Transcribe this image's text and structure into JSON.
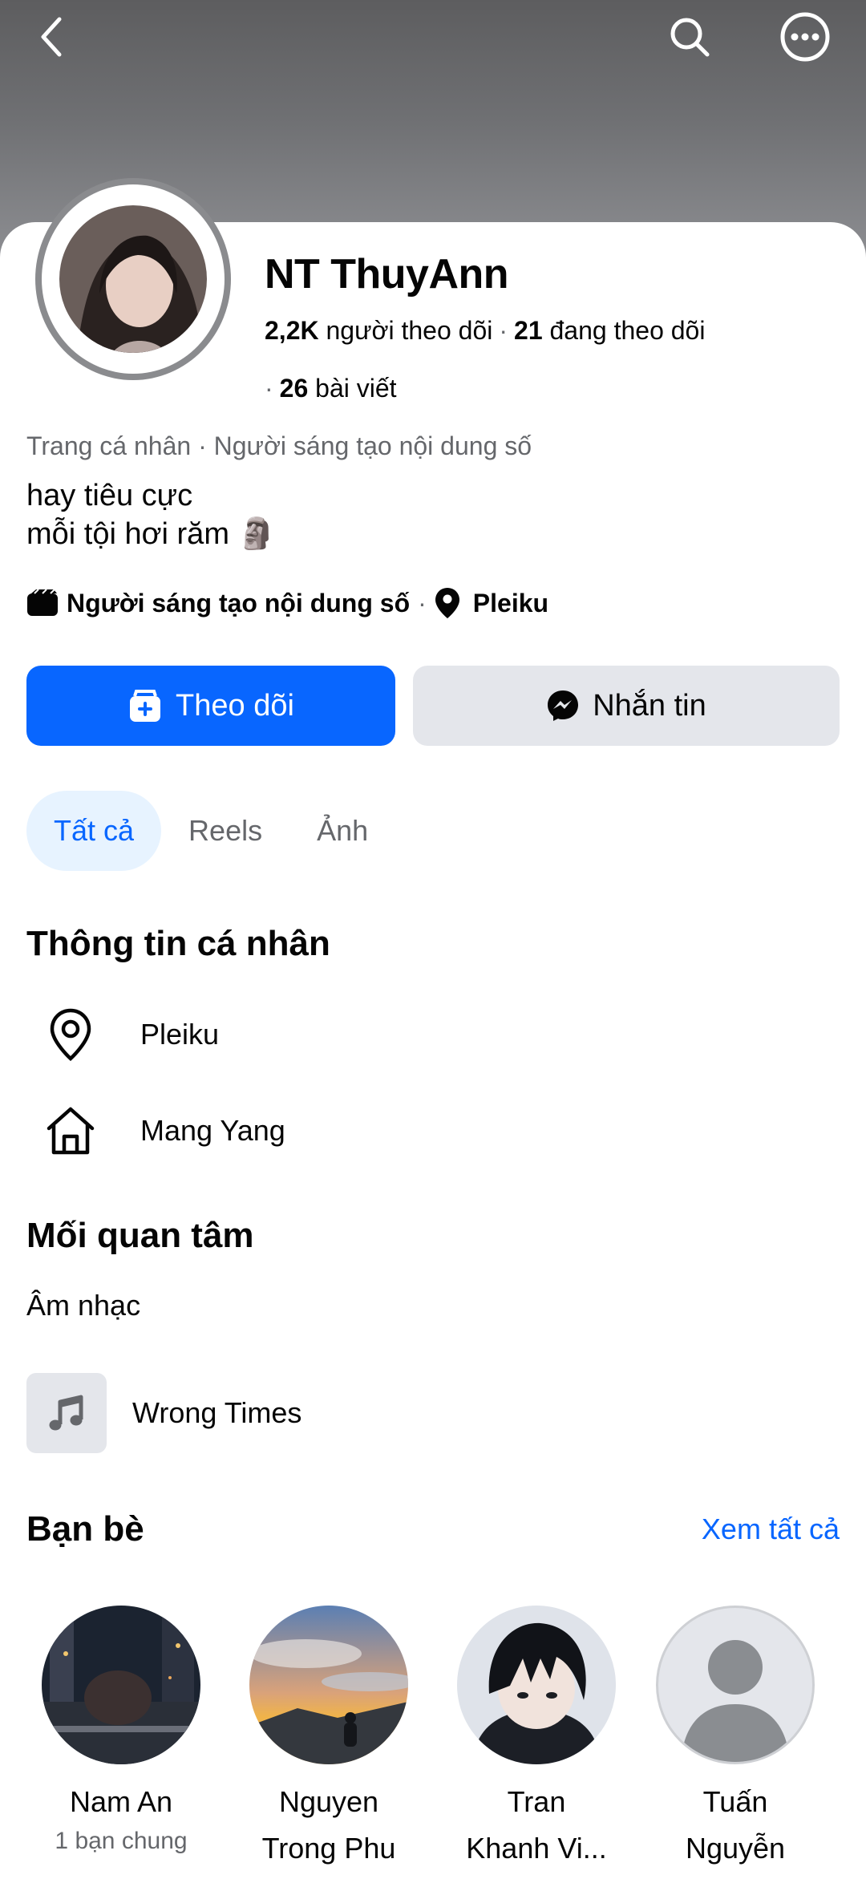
{
  "header": {
    "back_icon": "chevron-left-icon",
    "search_icon": "search-icon",
    "more_icon": "more-horizontal-icon"
  },
  "profile": {
    "name": "NT ThuyAnn",
    "followers_count": "2,2K",
    "followers_label": "người theo dõi",
    "following_count": "21",
    "following_label": "đang theo dõi",
    "posts_count": "26",
    "posts_label": "bài viết",
    "category": "Trang cá nhân · Người sáng tạo nội dung số",
    "bio_line1": "hay tiêu cực",
    "bio_line2": "mỗi tội hơi răm 🗿",
    "meta_creator": "Người sáng tạo nội dung số",
    "meta_location": "Pleiku"
  },
  "actions": {
    "follow_label": "Theo dõi",
    "message_label": "Nhắn tin"
  },
  "tabs": [
    {
      "label": "Tất cả",
      "active": true
    },
    {
      "label": "Reels",
      "active": false
    },
    {
      "label": "Ảnh",
      "active": false
    }
  ],
  "personal_info": {
    "title": "Thông tin cá nhân",
    "current_city": "Pleiku",
    "hometown": "Mang Yang"
  },
  "interests": {
    "title": "Mối quan tâm",
    "category": "Âm nhạc",
    "items": [
      {
        "label": "Wrong Times",
        "icon": "music-note-icon"
      }
    ]
  },
  "friends": {
    "title": "Bạn bè",
    "see_all": "Xem tất cả",
    "items": [
      {
        "name": "Nam An",
        "mutual": "1 bạn chung"
      },
      {
        "name_line1": "Nguyen",
        "name_line2": "Trong Phu"
      },
      {
        "name_line1": "Tran",
        "name_line2": "Khanh Vi..."
      },
      {
        "name_line1": "Tuấn",
        "name_line2": "Nguyễn"
      }
    ]
  },
  "colors": {
    "primary": "#0866ff",
    "secondary_button": "#e4e6eb",
    "muted_text": "#65676b",
    "active_tab_bg": "#e7f3ff"
  }
}
